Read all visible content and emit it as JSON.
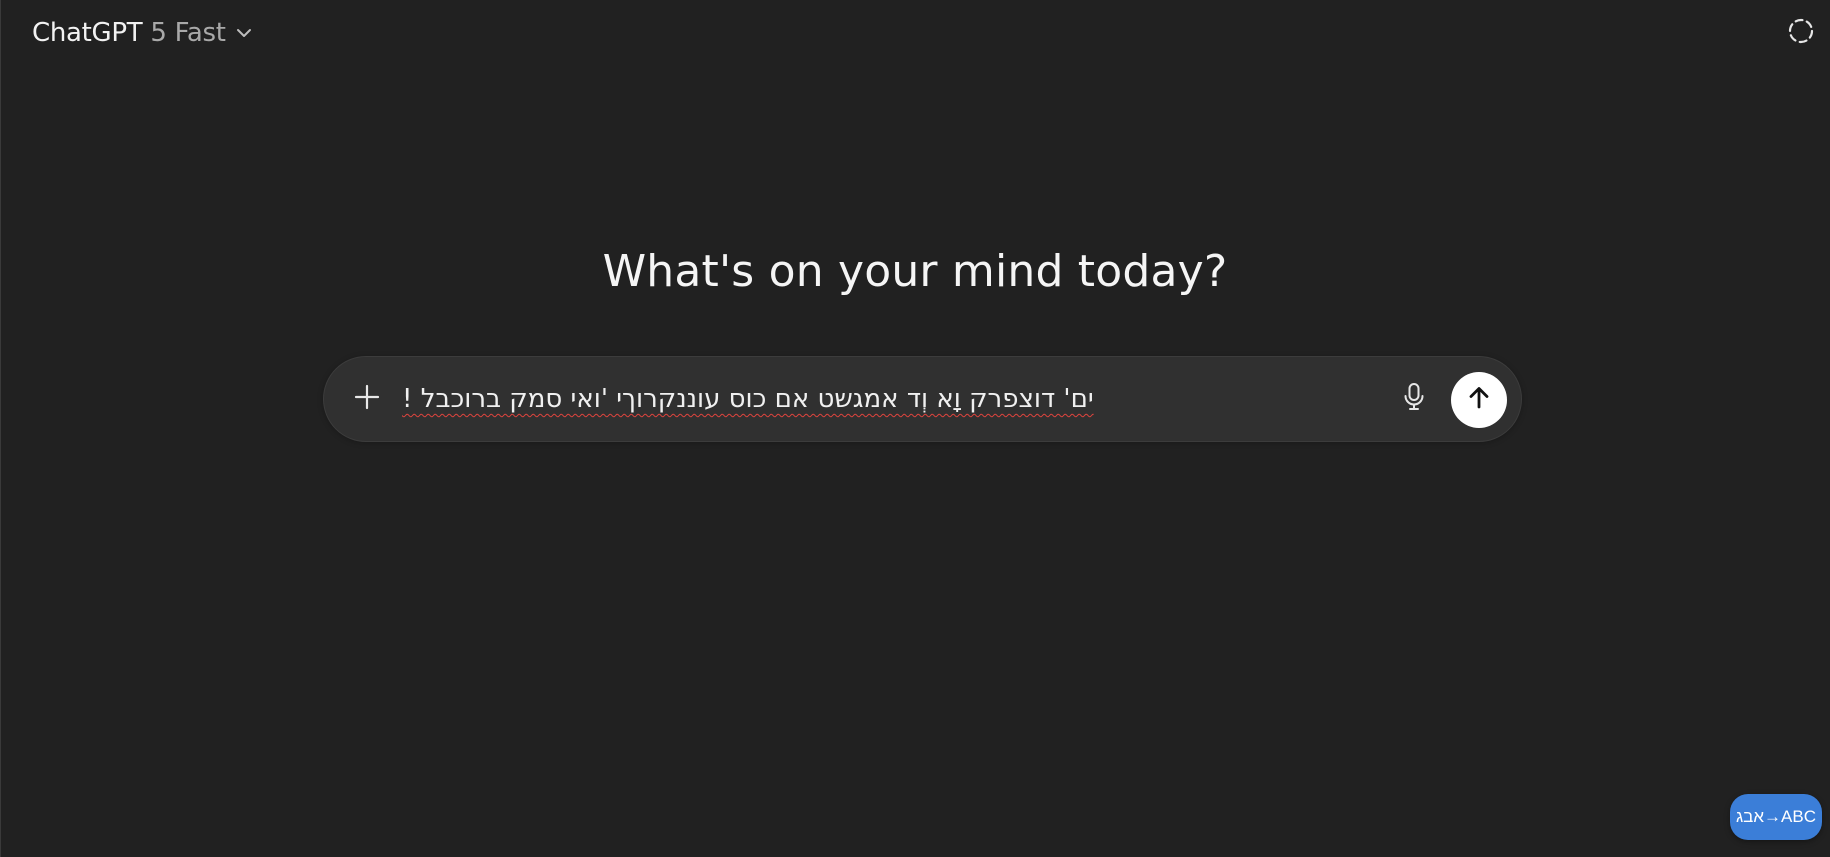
{
  "header": {
    "model_name": "ChatGPT",
    "model_variant": "5 Fast",
    "model_dropdown_icon": "chevron-down-icon",
    "temporary_chat_icon": "dashed-circle-icon"
  },
  "main": {
    "heading": "What's on your mind today?"
  },
  "composer": {
    "add_icon": "plus-icon",
    "input_value": "ים' דוצפרק וָא וְד אמגשט אם כוס עוננקרוךי 'ואי סמק ברוכבל !",
    "mic_icon": "microphone-icon",
    "send_icon": "arrow-up-icon"
  },
  "overlay": {
    "transliterate_label": "אבג→ABC"
  },
  "colors": {
    "background": "#212121",
    "composer_bg": "#303030",
    "send_button_bg": "#ffffff",
    "badge_bg": "#3b7ed8",
    "spellcheck_underline": "#e0443e"
  }
}
